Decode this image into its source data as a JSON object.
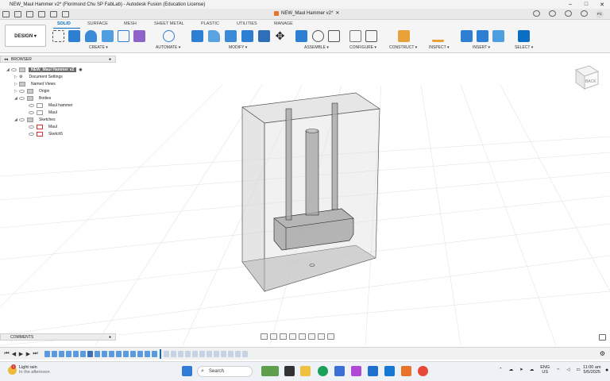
{
  "window": {
    "title": "NEW_Maul Hammer v2* (Florimond Chu SP FabLab) - Autodesk Fusion (Education License)",
    "doc_tab": "NEW_Maul Hammer v2*"
  },
  "ribbon": {
    "design_button": "DESIGN ▾",
    "tabs": [
      "SOLID",
      "SURFACE",
      "MESH",
      "SHEET METAL",
      "PLASTIC",
      "UTILITIES",
      "MANAGE"
    ],
    "groups": [
      "CREATE ▾",
      "AUTOMATE ▾",
      "MODIFY ▾",
      "ASSEMBLE ▾",
      "CONFIGURE ▾",
      "CONSTRUCT ▾",
      "INSPECT ▾",
      "INSERT ▾",
      "SELECT ▾"
    ]
  },
  "browser": {
    "header": "BROWSER",
    "root": "NEW_Maul Hammer v2",
    "items": [
      {
        "label": "Document Settings",
        "level": 1
      },
      {
        "label": "Named Views",
        "level": 1
      },
      {
        "label": "Origin",
        "level": 1
      },
      {
        "label": "Bodies",
        "level": 1
      },
      {
        "label": "Maul hammer",
        "level": 2
      },
      {
        "label": "Maul",
        "level": 2
      },
      {
        "label": "Sketches",
        "level": 1
      },
      {
        "label": "Maul",
        "level": 2
      },
      {
        "label": "Sketch5",
        "level": 2
      }
    ]
  },
  "viewcube": {
    "face": "BACK"
  },
  "comments": "COMMENTS",
  "user": {
    "initials": "FC"
  },
  "taskbar": {
    "weather_title": "Light rain",
    "weather_sub": "In the afternoon",
    "weather_badge": "1",
    "search": "Search",
    "lang_top": "ENG",
    "lang_bottom": "US",
    "time": "11:00 am",
    "date": "5/5/2025"
  },
  "colors": {
    "accent": "#0a6fc2",
    "fusion_orange": "#e8732a"
  }
}
